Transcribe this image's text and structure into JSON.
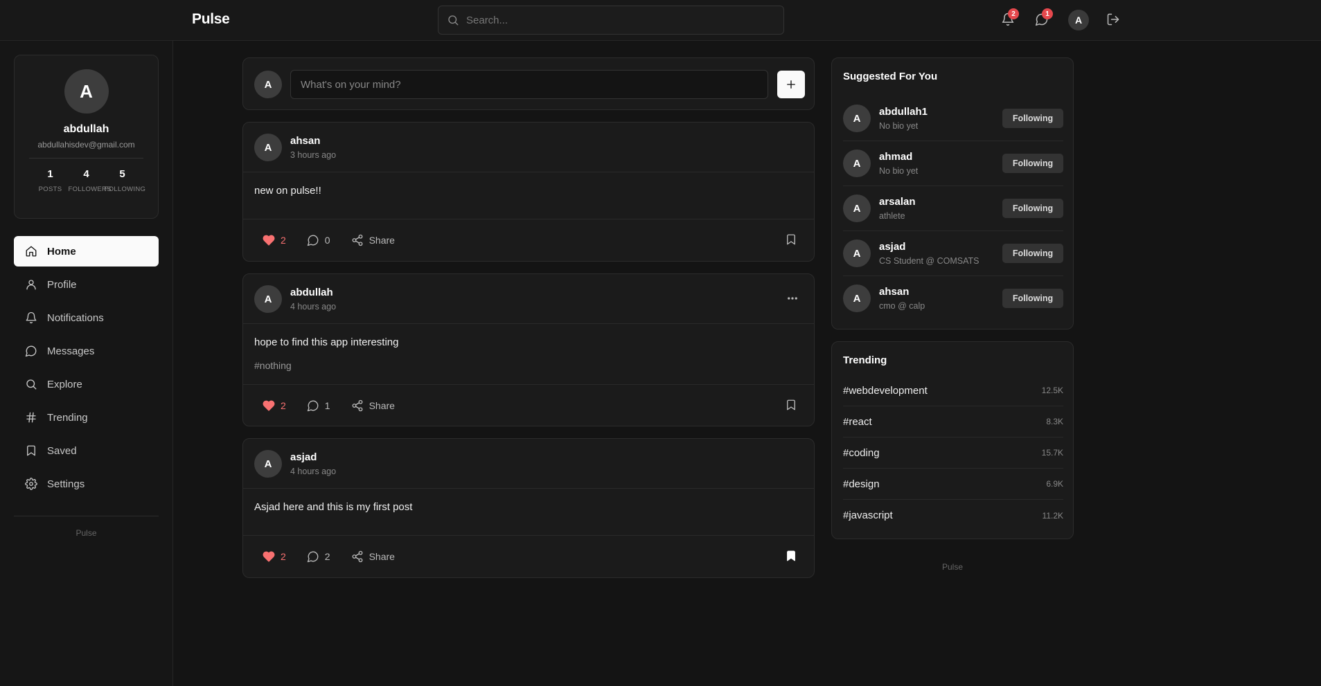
{
  "app": {
    "brand": "Pulse"
  },
  "search": {
    "placeholder": "Search..."
  },
  "topbar": {
    "notifications_count": "2",
    "messages_count": "1",
    "avatar_initial": "A"
  },
  "profile": {
    "initial": "A",
    "name": "abdullah",
    "email": "abdullahisdev@gmail.com",
    "stats": [
      {
        "value": "1",
        "label": "POSTS"
      },
      {
        "value": "4",
        "label": "FOLLOWERS"
      },
      {
        "value": "5",
        "label": "FOLLOWING"
      }
    ]
  },
  "nav": [
    {
      "label": "Home",
      "icon": "home-icon",
      "active": true
    },
    {
      "label": "Profile",
      "icon": "user-icon"
    },
    {
      "label": "Notifications",
      "icon": "bell-icon"
    },
    {
      "label": "Messages",
      "icon": "message-icon"
    },
    {
      "label": "Explore",
      "icon": "search-icon"
    },
    {
      "label": "Trending",
      "icon": "hash-icon"
    },
    {
      "label": "Saved",
      "icon": "bookmark-icon"
    },
    {
      "label": "Settings",
      "icon": "gear-icon"
    }
  ],
  "sidebar_footer": "Pulse",
  "composer": {
    "avatar_initial": "A",
    "placeholder": "What's on your mind?"
  },
  "posts": [
    {
      "initial": "A",
      "author": "ahsan",
      "time": "3 hours ago",
      "text": "new on pulse!!",
      "tag": "",
      "likes": "2",
      "comments": "0",
      "share_label": "Share",
      "bookmarked": false,
      "has_menu": false
    },
    {
      "initial": "A",
      "author": "abdullah",
      "time": "4 hours ago",
      "text": "hope to find this app interesting",
      "tag": "#nothing",
      "likes": "2",
      "comments": "1",
      "share_label": "Share",
      "bookmarked": false,
      "has_menu": true
    },
    {
      "initial": "A",
      "author": "asjad",
      "time": "4 hours ago",
      "text": "Asjad here and this is my first post",
      "tag": "",
      "likes": "2",
      "comments": "2",
      "share_label": "Share",
      "bookmarked": true,
      "has_menu": false
    }
  ],
  "suggested": {
    "title": "Suggested For You",
    "users": [
      {
        "initial": "A",
        "name": "abdullah1",
        "bio": "No bio yet",
        "button": "Following"
      },
      {
        "initial": "A",
        "name": "ahmad",
        "bio": "No bio yet",
        "button": "Following"
      },
      {
        "initial": "A",
        "name": "arsalan",
        "bio": "athlete",
        "button": "Following"
      },
      {
        "initial": "A",
        "name": "asjad",
        "bio": "CS Student @ COMSATS",
        "button": "Following"
      },
      {
        "initial": "A",
        "name": "ahsan",
        "bio": "cmo @ calp",
        "button": "Following"
      }
    ]
  },
  "trending": {
    "title": "Trending",
    "items": [
      {
        "tag": "#webdevelopment",
        "count": "12.5K"
      },
      {
        "tag": "#react",
        "count": "8.3K"
      },
      {
        "tag": "#coding",
        "count": "15.7K"
      },
      {
        "tag": "#design",
        "count": "6.9K"
      },
      {
        "tag": "#javascript",
        "count": "11.2K"
      }
    ]
  },
  "right_footer": "Pulse",
  "colors": {
    "background": "#141414",
    "like": "#f87171",
    "badge": "#e5484d",
    "active_nav": "#fafafa"
  }
}
